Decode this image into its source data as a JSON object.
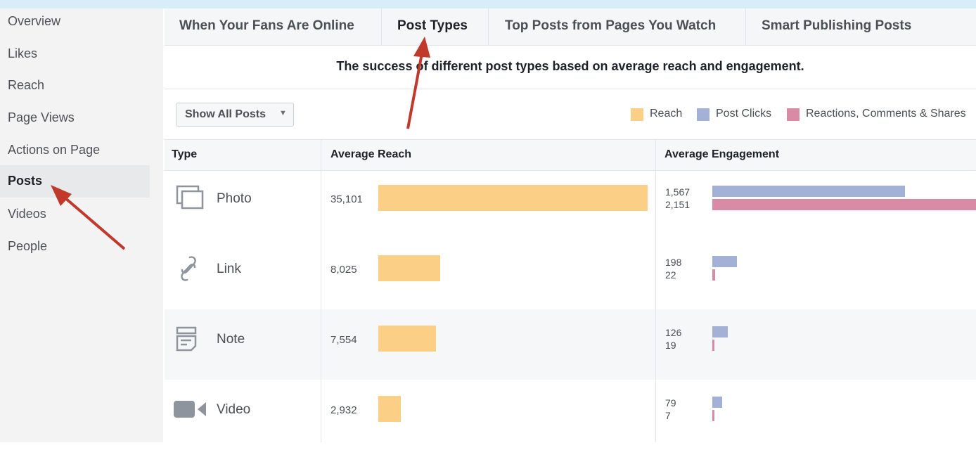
{
  "sidebar": {
    "items": [
      {
        "label": "Overview"
      },
      {
        "label": "Likes"
      },
      {
        "label": "Reach"
      },
      {
        "label": "Page Views"
      },
      {
        "label": "Actions on Page"
      },
      {
        "label": "Posts",
        "active": true
      },
      {
        "label": "Videos"
      },
      {
        "label": "People"
      }
    ]
  },
  "tabs": [
    {
      "label": "When Your Fans Are Online"
    },
    {
      "label": "Post Types",
      "active": true
    },
    {
      "label": "Top Posts from Pages You Watch"
    },
    {
      "label": "Smart Publishing Posts"
    }
  ],
  "subtitle": "The success of different post types based on average reach and engagement.",
  "filter": {
    "label": "Show All Posts",
    "caret": "▼"
  },
  "legend": [
    {
      "label": "Reach",
      "color": "#fbcf86"
    },
    {
      "label": "Post Clicks",
      "color": "#a3b1d6"
    },
    {
      "label": "Reactions, Comments & Shares",
      "color": "#d98ba5"
    }
  ],
  "table": {
    "headers": {
      "type": "Type",
      "reach": "Average Reach",
      "engagement": "Average Engagement"
    },
    "rows": [
      {
        "type": "Photo",
        "icon": "photo-icon",
        "reach": "35,101",
        "reach_value": 35101,
        "clicks": "1,567",
        "clicks_value": 1567,
        "reactions": "2,151",
        "reactions_value": 2151
      },
      {
        "type": "Link",
        "icon": "link-icon",
        "reach": "8,025",
        "reach_value": 8025,
        "clicks": "198",
        "clicks_value": 198,
        "reactions": "22",
        "reactions_value": 22
      },
      {
        "type": "Note",
        "icon": "note-icon",
        "reach": "7,554",
        "reach_value": 7554,
        "clicks": "126",
        "clicks_value": 126,
        "reactions": "19",
        "reactions_value": 19
      },
      {
        "type": "Video",
        "icon": "video-icon",
        "reach": "2,932",
        "reach_value": 2932,
        "clicks": "79",
        "clicks_value": 79,
        "reactions": "7",
        "reactions_value": 7
      }
    ]
  },
  "colors": {
    "reach": "#fbcf86",
    "clicks": "#a3b1d6",
    "reactions": "#d98ba5",
    "annotation_arrow": "#c0392b",
    "background_frame": "#d7eef9"
  }
}
